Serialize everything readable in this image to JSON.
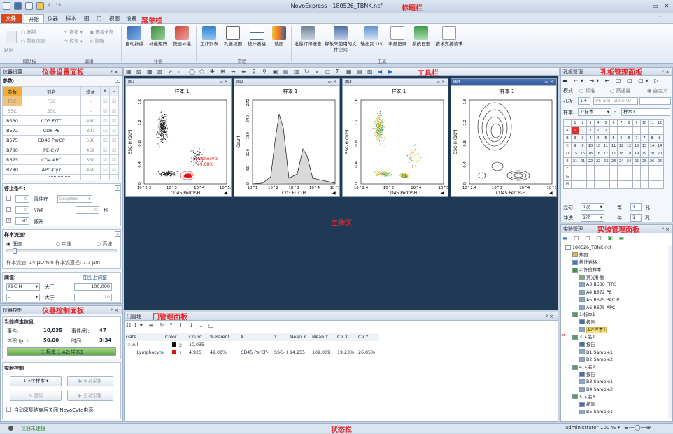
{
  "window": {
    "title": "NovoExpress - 180526_TBNK.ncf",
    "min": "–",
    "max": "▭",
    "close": "✕"
  },
  "annotations": {
    "title_bar": "标题栏",
    "menu_bar": "菜单栏",
    "toolbar": "工具栏",
    "instrument_settings": "仪器设置面板",
    "instrument_control": "仪器控制面板",
    "work_area": "工作区",
    "gate_manager": "门管理面板",
    "plate_manager": "孔板管理面板",
    "experiment_manager": "实验管理面板",
    "status_bar": "状态栏"
  },
  "menu": [
    "文件",
    "开始",
    "仪器",
    "样本",
    "图",
    "门",
    "视图",
    "设置"
  ],
  "ribbon": {
    "clipboard": {
      "copy": "复制",
      "paste": "粘贴",
      "dup_create": "重复创建",
      "undo": "撤销",
      "redo": "恢复",
      "select_all": "选择全部",
      "delete": "删除",
      "group": "剪贴板"
    },
    "edit_group": "编辑",
    "comp": {
      "auto": "自动补偿",
      "matrix": "补偿矩阵",
      "fast": "快速补偿",
      "group": "补偿"
    },
    "exp": {
      "worklist": "工作列表",
      "plate_view": "孔板视图",
      "stats": "统计表格",
      "heatmap": "热图",
      "group": "实验"
    },
    "tools": {
      "batch_print": "批量打印报告",
      "release": "释放未使用的文件空间",
      "lis": "输出到 LIS",
      "events": "事务记录",
      "syslog": "系统日志",
      "support": "技术支持请求",
      "group": "工具"
    }
  },
  "instrument_settings": {
    "header": "仪器设置",
    "params_label": "参数:",
    "columns": [
      "参数",
      "列名",
      "增益",
      "A",
      "H"
    ],
    "rows": [
      {
        "param": "FSC",
        "name": "FSC",
        "gain": "-"
      },
      {
        "param": "SSC",
        "name": "SSC",
        "gain": "-"
      },
      {
        "param": "B530",
        "name": "CD3 FITC",
        "gain": "480"
      },
      {
        "param": "B572",
        "name": "CD8 PE",
        "gain": "397"
      },
      {
        "param": "B675",
        "name": "CD45 PerCP",
        "gain": "530"
      },
      {
        "param": "B780",
        "name": "PE-Cy7",
        "gain": "459"
      },
      {
        "param": "R675",
        "name": "CD4 APC",
        "gain": "530"
      },
      {
        "param": "R780",
        "name": "APC-Cy7",
        "gain": "459"
      }
    ],
    "stop": {
      "title": "停止条件:",
      "events_label": "事件在",
      "events_value": "0",
      "gate": "Ungated",
      "minutes_value": "0",
      "minutes_label": "分钟",
      "seconds_value": "0",
      "seconds_label": "秒",
      "volume_value": "50",
      "volume_label": "微升"
    },
    "flow": {
      "title": "样本流速:",
      "low": "低速",
      "mid": "中速",
      "high": "高速",
      "info": "样本流速: 14 μL/min  样本流直径: 7.7 μm",
      "level": 0.05
    },
    "threshold": {
      "title": "阈值:",
      "adjust": "在图上调整",
      "param1": "FSC-H",
      "op1": "大于",
      "val1": "100,000",
      "param2": "-",
      "op2": "大于",
      "val2": "10"
    }
  },
  "instrument_control": {
    "header": "仪器控制",
    "current_title": "当前样本信息",
    "events_label": "事件:",
    "events_value": "10,035",
    "rate_label": "事件/秒:",
    "rate_value": "47",
    "volume_label": "体积 (μL):",
    "volume_value": "50.00",
    "time_label": "时间:",
    "time_value": "3:34",
    "progress_label": "1:标本 1-A2:样本1",
    "progress": 1.0,
    "exp_title": "实验控制",
    "next_sample": "下个样本",
    "single": "单孔采集",
    "mix": "混匀",
    "auto": "自动采集",
    "autooff": "自动采集结束后关闭 NovoCyte电源"
  },
  "plots": [
    {
      "tab": "图1",
      "title": "样本 1",
      "xlabel": "CD45 PerCP-H",
      "ylabel": "SSC-H (10⁶)",
      "x_ticks": [
        "10^2.3",
        "10^3",
        "10^4",
        "10^5.1"
      ],
      "y_ticks": [
        "0",
        "0.4",
        "0.8",
        "1.2",
        "1.6"
      ],
      "gate_label": "Lymphocyte",
      "gate_pct": "49.08%"
    },
    {
      "tab": "图2",
      "title": "样本 1",
      "xlabel": "CD3 FITC-H",
      "ylabel": "Count",
      "x_ticks": [
        "10^1",
        "10^2",
        "10^3",
        "10^4",
        "10^5"
      ],
      "y_ticks": [
        "0",
        "60",
        "120",
        "180",
        "240",
        "272"
      ]
    },
    {
      "tab": "图3",
      "title": "样本 1",
      "xlabel": "CD45 PerCP-H",
      "ylabel": "SSC-H (10⁶)",
      "x_ticks": [
        "10^2.4",
        "10^3",
        "10^4",
        "10^5"
      ],
      "y_ticks": [
        "0",
        "0.4",
        "0.8",
        "1.2",
        "1.6"
      ]
    },
    {
      "tab": "图4",
      "title": "样本 1",
      "xlabel": "CD45 PerCP-H",
      "ylabel": "SSC-H (10⁶)",
      "x_ticks": [
        "10^2.4",
        "10^3",
        "10^4",
        "10^5"
      ],
      "y_ticks": [
        "0",
        "0.4",
        "0.8",
        "1.2",
        "1.6"
      ]
    }
  ],
  "gate_manager": {
    "header": "门管理",
    "columns": [
      "Gate",
      "Color",
      "Count",
      "% Parent",
      "X",
      "Y",
      "Mean X",
      "Mean Y",
      "CV X",
      "CV Y"
    ],
    "rows": [
      {
        "gate": "All",
        "color_idx": "2",
        "count": "10,035",
        "parent": "",
        "x": "",
        "y": "",
        "mx": "",
        "my": "",
        "cvx": "",
        "cvy": "",
        "color": "#111111"
      },
      {
        "gate": "Lymphocyte",
        "color_idx": "1",
        "count": "4,925",
        "parent": "49.08%",
        "x": "CD45 PerCP-H",
        "y": "SSC-H",
        "mx": "14,255",
        "my": "109,069",
        "cvx": "19.23%",
        "cvy": "26.85%",
        "color": "#e01010"
      }
    ]
  },
  "plate": {
    "header": "孔板管理",
    "mode_label": "模式:",
    "modes": [
      "标准",
      "高通量",
      "自定义"
    ],
    "plate_label": "孔板:",
    "plate_value": "1",
    "plate_type": "96 well plate (U-",
    "sample_label": "样本:",
    "sample_value": "1:标本1",
    "sample_name": "样本1",
    "cols": [
      "1",
      "2",
      "3",
      "4",
      "5",
      "6",
      "7",
      "8",
      "9",
      "10",
      "11",
      "12"
    ],
    "rows": [
      "A",
      "B",
      "C",
      "D",
      "E",
      "F",
      "G",
      "H"
    ],
    "filled": [
      [
        "1",
        "2",
        "2",
        "2",
        "2",
        "",
        "",
        "",
        "",
        "",
        "",
        ""
      ],
      [
        "3",
        "3",
        "4",
        "4",
        "5",
        "5",
        "6",
        "6",
        "7",
        "7",
        "8",
        "8"
      ],
      [
        "9",
        "9",
        "10",
        "10",
        "11",
        "11",
        "12",
        "12",
        "13",
        "13",
        "14",
        "14"
      ],
      [
        "15",
        "15",
        "16",
        "16",
        "17",
        "17",
        "18",
        "18",
        "19",
        "19",
        "20",
        "20"
      ],
      [
        "21",
        "21",
        "22",
        "22",
        "23",
        "23",
        "24",
        "24",
        "25",
        "25",
        "26",
        "26"
      ],
      [
        "",
        "",
        "",
        "",
        "",
        "",
        "",
        "",
        "",
        "",
        "",
        ""
      ],
      [
        "",
        "",
        "",
        "",
        "",
        "",
        "",
        "",
        "",
        "",
        "",
        ""
      ],
      [
        "",
        "",
        "",
        "",
        "",
        "",
        "",
        "",
        "",
        "",
        "",
        ""
      ]
    ],
    "mix_label": "混匀",
    "mix_value": "1次",
    "every1": "每",
    "every1_val": "1",
    "unit1": "孔",
    "rinse_label": "冲洗",
    "rinse_value": "1次",
    "every2": "每",
    "every2_val": "1",
    "unit2": "孔"
  },
  "experiment": {
    "header": "实验管理",
    "tree": [
      {
        "indent": 0,
        "text": "180526_TBNK.ncf",
        "icon": "file"
      },
      {
        "indent": 1,
        "text": "热图",
        "icon": "heat"
      },
      {
        "indent": 1,
        "text": "统计表格",
        "icon": "table"
      },
      {
        "indent": 1,
        "text": "2:补偿样本",
        "icon": "folder"
      },
      {
        "indent": 2,
        "text": "荧光补偿",
        "icon": "comp"
      },
      {
        "indent": 2,
        "text": "A3:B530 FITC",
        "icon": "tube"
      },
      {
        "indent": 2,
        "text": "A4:B572 PE",
        "icon": "tube"
      },
      {
        "indent": 2,
        "text": "A5:B675 PerCP",
        "icon": "tube"
      },
      {
        "indent": 2,
        "text": "A6:R675 APC",
        "icon": "tube"
      },
      {
        "indent": 1,
        "text": "1:标本1",
        "icon": "person"
      },
      {
        "indent": 2,
        "text": "报告",
        "icon": "report"
      },
      {
        "indent": 2,
        "text": "A2:样本1",
        "icon": "tube",
        "selected": true
      },
      {
        "indent": 1,
        "text": "3:人名1",
        "icon": "person"
      },
      {
        "indent": 2,
        "text": "报告",
        "icon": "report"
      },
      {
        "indent": 2,
        "text": "B1:Sample1",
        "icon": "tube"
      },
      {
        "indent": 2,
        "text": "B2:Sample2",
        "icon": "tube"
      },
      {
        "indent": 1,
        "text": "4:人名2",
        "icon": "person"
      },
      {
        "indent": 2,
        "text": "报告",
        "icon": "report"
      },
      {
        "indent": 2,
        "text": "B3:Sample1",
        "icon": "tube"
      },
      {
        "indent": 2,
        "text": "B4:Sample2",
        "icon": "tube"
      },
      {
        "indent": 1,
        "text": "5:人名3",
        "icon": "person"
      },
      {
        "indent": 2,
        "text": "报告",
        "icon": "report"
      },
      {
        "indent": 2,
        "text": "B5:Sample1",
        "icon": "tube"
      }
    ]
  },
  "status": {
    "connection": "仪器未连接",
    "user": "administrator",
    "zoom": "100 %"
  }
}
